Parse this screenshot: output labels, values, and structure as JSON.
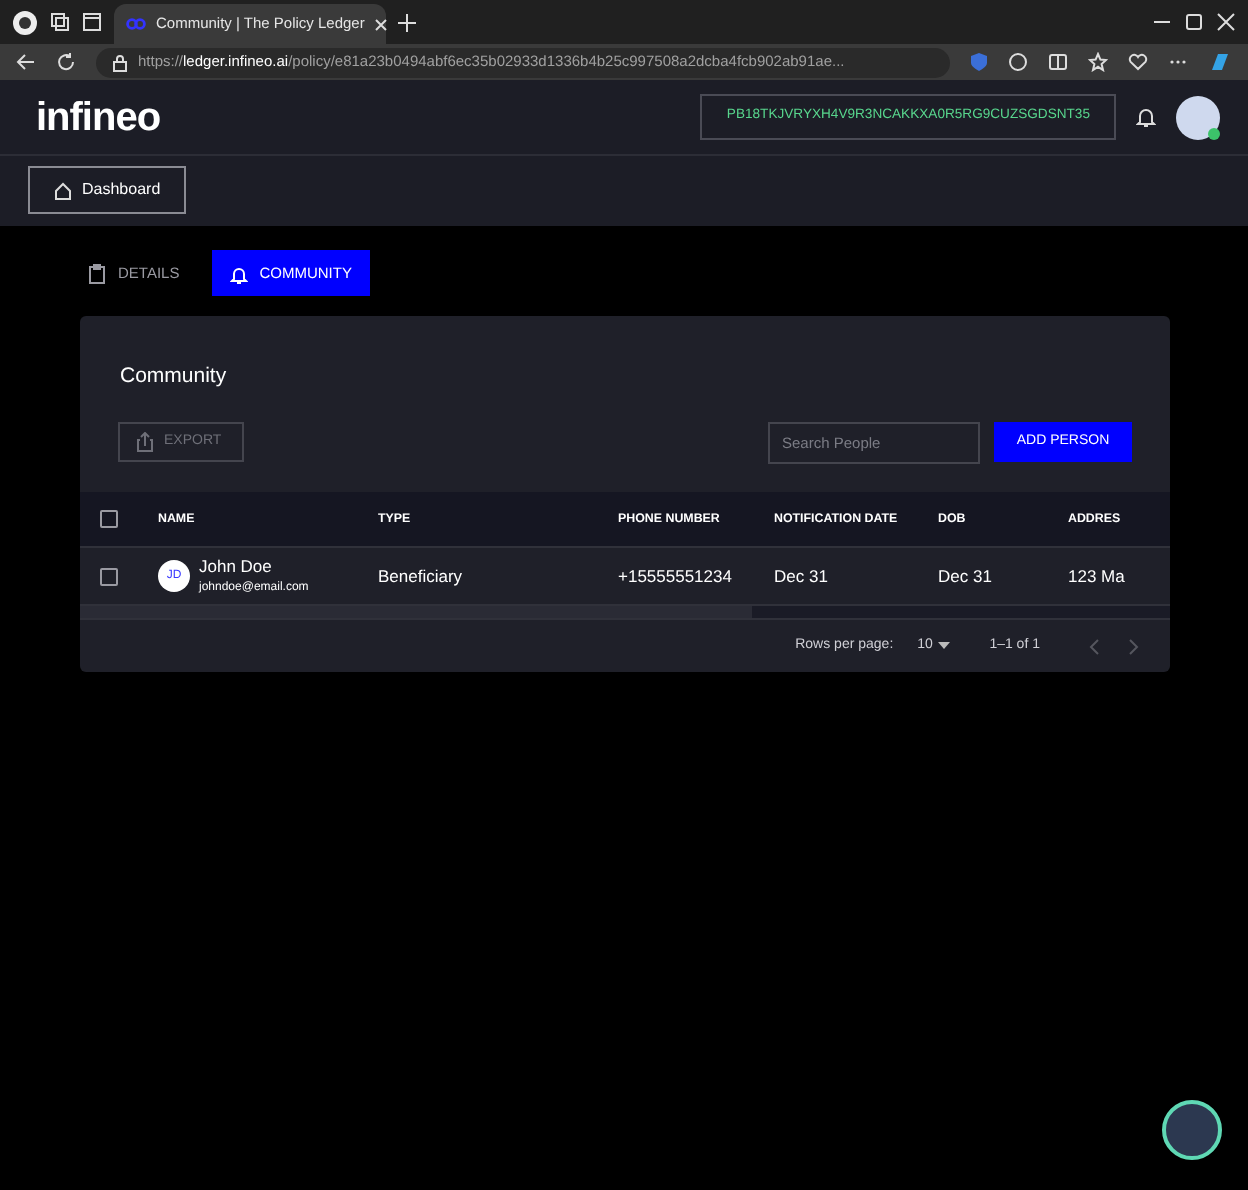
{
  "browser": {
    "tab_title": "Community | The Policy Ledger",
    "url_scheme": "https://",
    "url_host": "ledger.infineo.ai",
    "url_path": "/policy/e81a23b0494abf6ec35b02933d1336b4b25c997508a2dcba4fcb902ab91ae..."
  },
  "header": {
    "logo": "infineo",
    "policy_id": "PB18TKJVRYXH4V9R3NCAKKXA0R5RG9CUZSGDSNT35",
    "online": true
  },
  "nav": {
    "dashboard": "Dashboard"
  },
  "tabs": [
    {
      "label": "DETAILS",
      "selected": false,
      "kind": "clipboard"
    },
    {
      "label": "COMMUNITY",
      "selected": true,
      "kind": "bell"
    }
  ],
  "card": {
    "title": "Community",
    "export": "EXPORT",
    "export_disabled": true,
    "search": {
      "placeholder": "Search People"
    },
    "add": "ADD PERSON"
  },
  "table": {
    "columns": [
      "NAME",
      "TYPE",
      "PHONE NUMBER",
      "NOTIFICATION DATE",
      "DOB",
      "ADDRES"
    ],
    "all_checked": false,
    "rows": [
      {
        "checked": false,
        "initials": "JD",
        "name": "John Doe",
        "email": "johndoe@email.com",
        "type": "Beneficiary",
        "phone": "+15555551234",
        "notification_date": "Dec 31",
        "dob": "Dec 31",
        "address": "123 Ma"
      }
    ]
  },
  "pagination": {
    "rows_label": "Rows per page:",
    "rows_value": "10",
    "range": "1–1 of 1",
    "prev_disabled": true,
    "next_disabled": true
  }
}
